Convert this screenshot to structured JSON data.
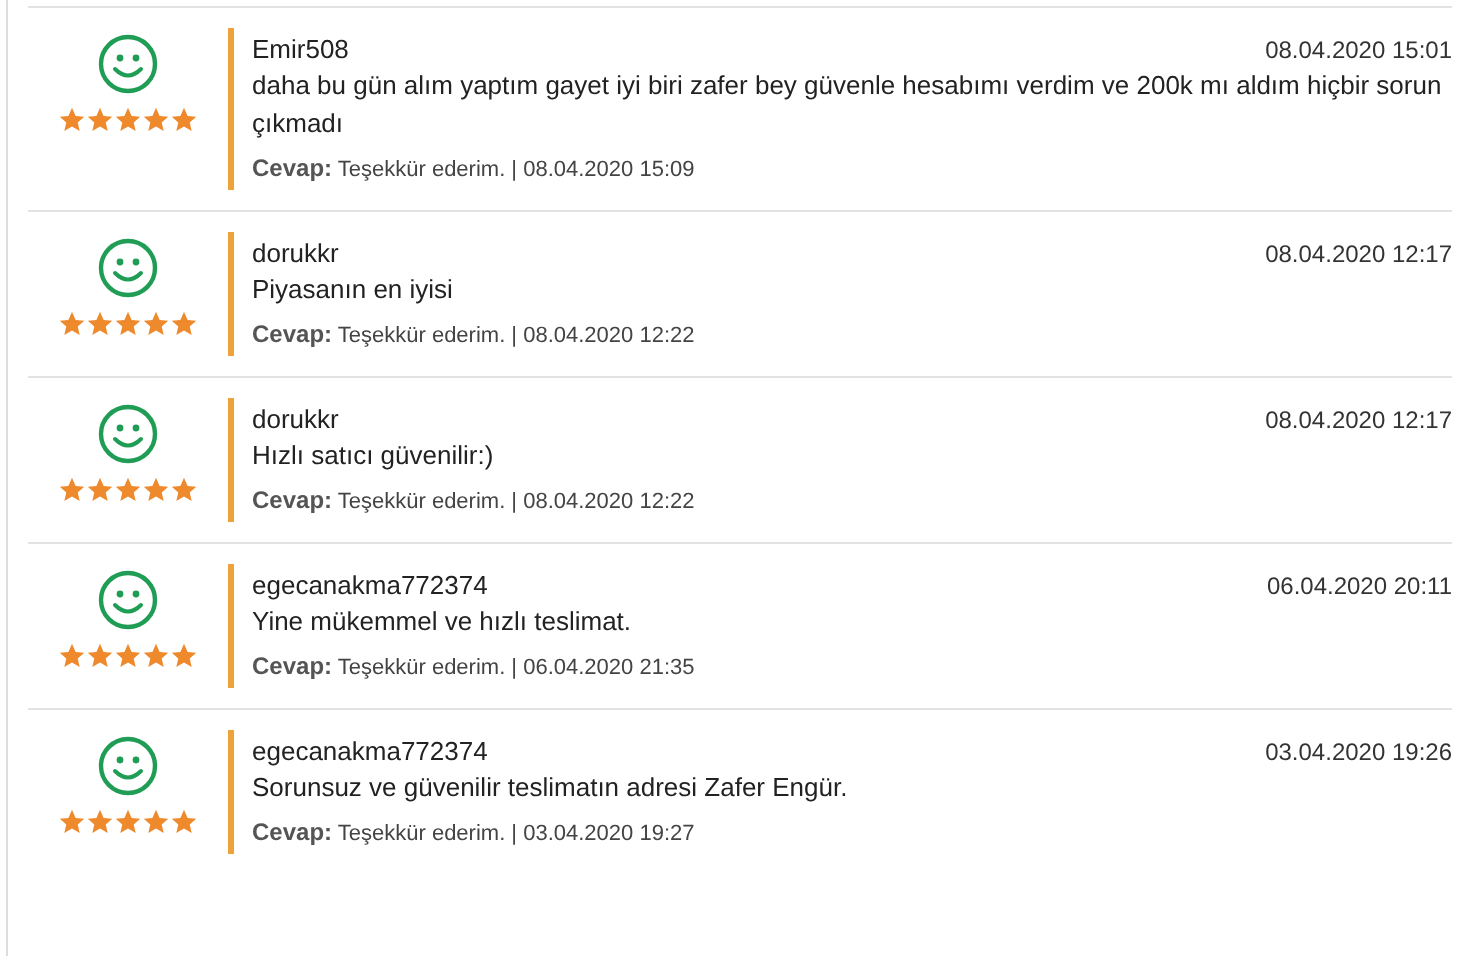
{
  "reviews": [
    {
      "user": "Emir508",
      "date": "08.04.2020 15:01",
      "stars": 5,
      "comment": "daha bu gün alım yaptım gayet iyi biri zafer bey güvenle hesabımı verdim ve 200k mı aldım hiçbir sorun çıkmadı",
      "reply": "**Cevap:** Teşekkür ederim. | 08.04.2020 15:09"
    },
    {
      "user": "dorukkr",
      "date": "08.04.2020 12:17",
      "stars": 5,
      "comment": "Piyasanın en iyisi",
      "reply": "**Cevap:** Teşekkür ederim. | 08.04.2020 12:22"
    },
    {
      "user": "dorukkr",
      "date": "08.04.2020 12:17",
      "stars": 5,
      "comment": "Hızlı satıcı güvenilir:)",
      "reply": "**Cevap:** Teşekkür ederim. | 08.04.2020 12:22"
    },
    {
      "user": "egecanakma772374",
      "date": "06.04.2020 20:11",
      "stars": 5,
      "comment": "Yine mükemmel ve hızlı teslimat.",
      "reply": "**Cevap:** Teşekkür ederim. | 06.04.2020 21:35"
    },
    {
      "user": "egecanakma772374",
      "date": "03.04.2020 19:26",
      "stars": 5,
      "comment": "Sorunsuz ve güvenilir teslimatın adresi Zafer Engür.",
      "reply": "**Cevap:** Teşekkür ederim. | 03.04.2020 19:27"
    }
  ]
}
